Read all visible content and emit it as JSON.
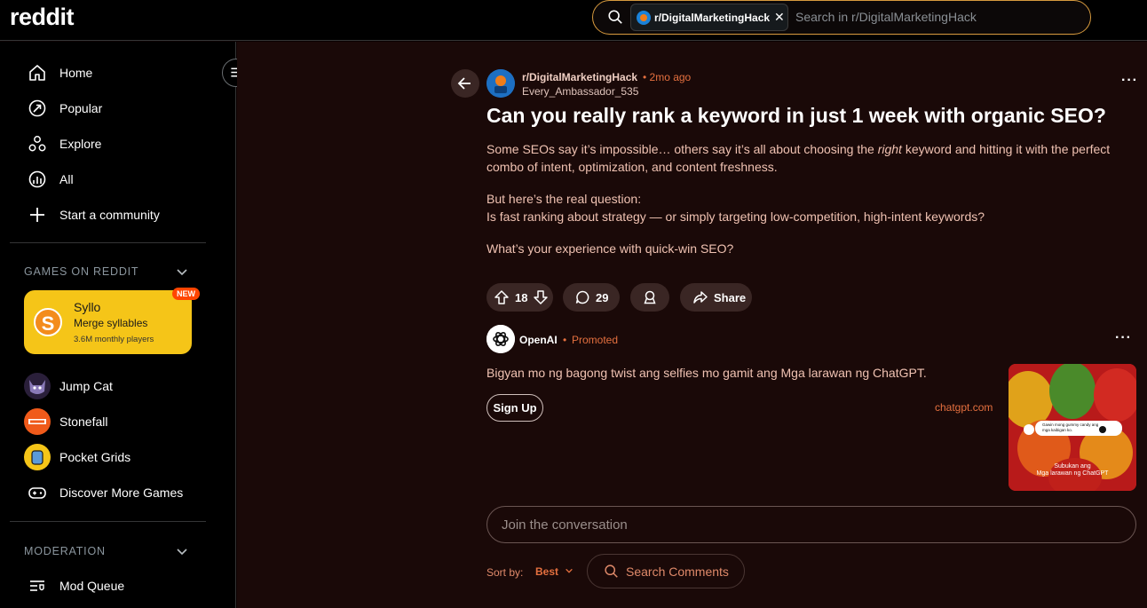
{
  "header": {
    "logo": "reddit",
    "search_chip": "r/DigitalMarketingHack",
    "search_placeholder": "Search in r/DigitalMarketingHack"
  },
  "sidebar": {
    "nav": [
      {
        "label": "Home",
        "icon": "home-icon"
      },
      {
        "label": "Popular",
        "icon": "popular-icon"
      },
      {
        "label": "Explore",
        "icon": "explore-icon"
      },
      {
        "label": "All",
        "icon": "all-icon"
      },
      {
        "label": "Start a community",
        "icon": "plus-icon"
      }
    ],
    "games_header": "GAMES ON REDDIT",
    "featured_game": {
      "name": "Syllo",
      "tagline": "Merge syllables",
      "players": "3.6M monthly players",
      "badge": "NEW"
    },
    "games": [
      {
        "label": "Jump Cat"
      },
      {
        "label": "Stonefall"
      },
      {
        "label": "Pocket Grids"
      },
      {
        "label": "Discover More Games"
      }
    ],
    "moderation_header": "MODERATION",
    "moderation_items": [
      {
        "label": "Mod Queue"
      }
    ]
  },
  "post": {
    "subreddit": "r/DigitalMarketingHack",
    "time": "• 2mo ago",
    "author": "Every_Ambassador_535",
    "title": "Can you really rank a keyword in just 1 week with organic SEO?",
    "p1_a": "Some SEOs say it’s impossible… others say it’s all about choosing the ",
    "p1_em": "right",
    "p1_b": " keyword and hitting it with the perfect combo of intent, optimization, and content freshness.",
    "p2_line1": "But here’s the real question:",
    "p2_line2": "Is fast ranking about strategy — or simply targeting low-competition, high-intent keywords?",
    "p3": "What’s your experience with quick-win SEO?",
    "votes": "18",
    "comments": "29",
    "share_label": "Share"
  },
  "ad": {
    "advertiser": "OpenAI",
    "separator": "•",
    "promoted": "Promoted",
    "text": "Bigyan mo ng bagong twist ang selfies mo gamit ang Mga larawan ng ChatGPT.",
    "cta": "Sign Up",
    "domain": "chatgpt.com",
    "image_caption_line1": "Subukan ang",
    "image_caption_line2": "Mga larawan ng ChatGPT",
    "image_bubble": "Gawin mong gummy candy ang mga kaibigan ko."
  },
  "comments": {
    "join_placeholder": "Join the conversation",
    "sort_label": "Sort by:",
    "sort_value": "Best",
    "search_label": "Search Comments"
  }
}
